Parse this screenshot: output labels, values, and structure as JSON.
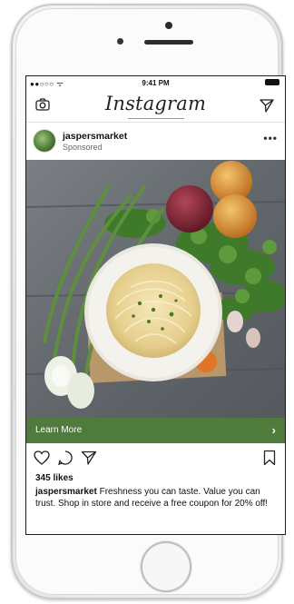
{
  "status_bar": {
    "carrier": "●●○○○ ᯤ",
    "time": "9:41 PM"
  },
  "nav": {
    "logo": "Instagram",
    "left_icon": "camera-icon",
    "right_icon": "send-icon"
  },
  "post": {
    "username": "jaspersmarket",
    "subtitle": "Sponsored",
    "more_label": "•••",
    "image_description_icon": "pasta-bowl-photo",
    "cta_label": "Learn More",
    "cta_chevron": "›",
    "likes": "345 likes",
    "caption_user": "jaspersmarket",
    "caption_text": " Freshness you can taste. Value you can trust. Shop in store and receive a free coupon for 20% off!"
  },
  "colors": {
    "cta_green": "#4f7b3d",
    "text": "#111111"
  }
}
